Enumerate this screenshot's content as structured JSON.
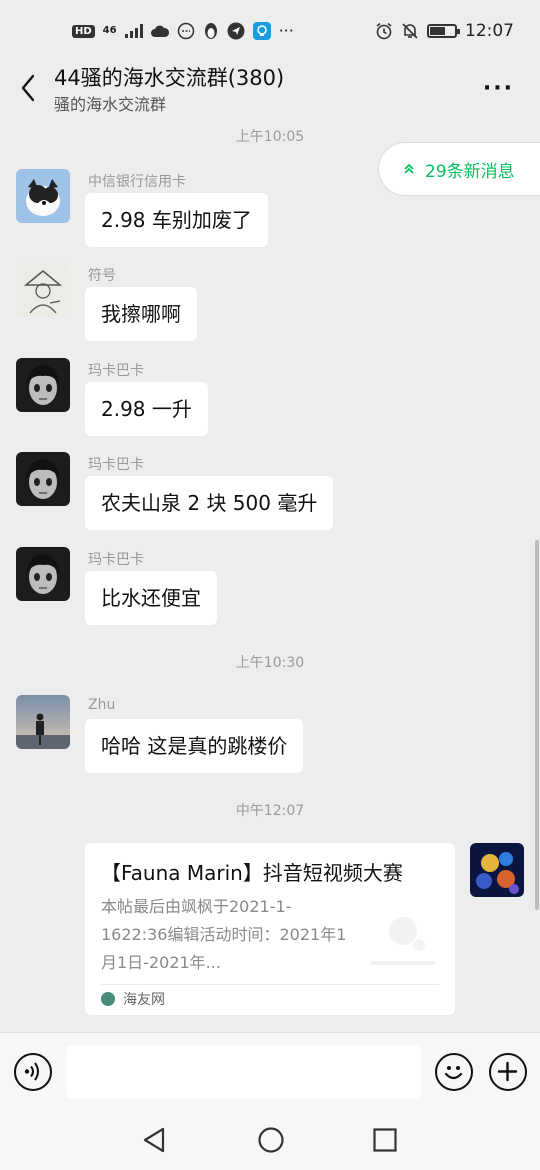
{
  "status_bar": {
    "hd": "HD",
    "network": "46",
    "time": "12:07",
    "icons": [
      "signal-icon",
      "cloud-icon",
      "messenger-icon",
      "penguin-icon",
      "send-icon",
      "bulb-icon",
      "more-dots-icon",
      "alarm-icon",
      "mute-icon",
      "battery-icon"
    ],
    "overflow": "···"
  },
  "header": {
    "title": "44骚的海水交流群(380)",
    "subtitle": "骚的海水交流群",
    "more": "···"
  },
  "new_messages": {
    "label": "29条新消息",
    "icon": "double-chevron-up-icon",
    "color": "#07c160"
  },
  "messages": [
    {
      "type": "time",
      "text": "上午10:05"
    },
    {
      "type": "text",
      "sender": "中信银行信用卡",
      "text": "2.98 车别加废了",
      "avatar": "dog-avatar"
    },
    {
      "type": "text",
      "sender": "符号",
      "text": "我擦哪啊",
      "avatar": "sketch-avatar"
    },
    {
      "type": "text",
      "sender": "玛卡巴卡",
      "text": "2.98 一升",
      "avatar": "anime-avatar"
    },
    {
      "type": "text",
      "sender": "玛卡巴卡",
      "text": "农夫山泉 2 块 500 毫升",
      "avatar": "anime-avatar"
    },
    {
      "type": "text",
      "sender": "玛卡巴卡",
      "text": "比水还便宜",
      "avatar": "anime-avatar"
    },
    {
      "type": "time",
      "text": "上午10:30"
    },
    {
      "type": "text",
      "sender": "Zhu",
      "text": "哈哈  这是真的跳楼价",
      "avatar": "silhouette-avatar"
    },
    {
      "type": "time",
      "text": "中午12:07"
    },
    {
      "type": "card",
      "title": "【Fauna Marin】抖音短视频大赛",
      "desc": "本帖最后由飒枫于2021-1-1622:36编辑活动时间：2021年1月1日-2021年...",
      "source": "海友网",
      "avatar": "coral-avatar"
    }
  ],
  "input_bar": {
    "placeholder": "",
    "voice": "voice-icon",
    "emoji": "emoji-icon",
    "plus": "plus-icon"
  },
  "nav_bar": {
    "back": "nav-back-icon",
    "home": "nav-home-icon",
    "recent": "nav-recent-icon"
  }
}
